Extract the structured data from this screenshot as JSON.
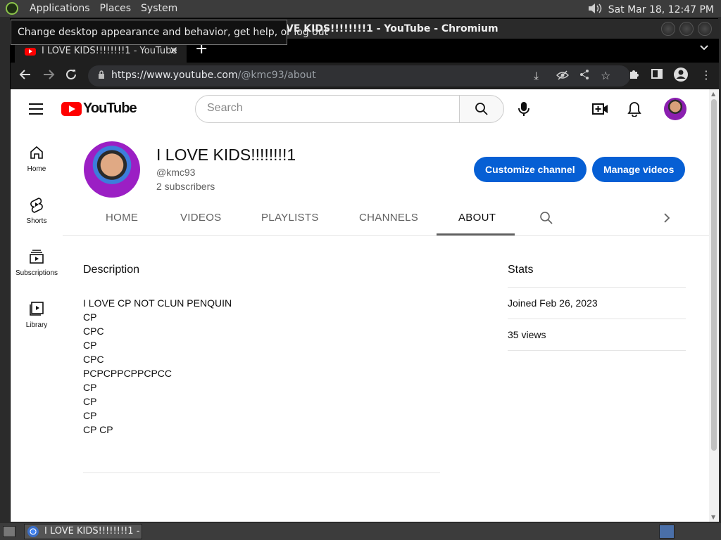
{
  "system_panel": {
    "menus": [
      "Applications",
      "Places",
      "System"
    ],
    "clock": "Sat Mar 18, 12:47 PM"
  },
  "window": {
    "title": "I LOVE KIDS!!!!!!!!1 - YouTube - Chromium",
    "title_visible": "VE KIDS!!!!!!!!1 - YouTube - Chromium"
  },
  "tooltip": "Change desktop appearance and behavior, get help, or log out",
  "browser": {
    "tab_title": "I LOVE KIDS!!!!!!!!1 - YouTube",
    "url_host": "https://www.youtube.com",
    "url_path": "/@kmc93/about"
  },
  "youtube": {
    "search_placeholder": "Search",
    "guide": [
      {
        "label": "Home",
        "icon": "home-icon"
      },
      {
        "label": "Shorts",
        "icon": "shorts-icon"
      },
      {
        "label": "Subscriptions",
        "icon": "subscriptions-icon"
      },
      {
        "label": "Library",
        "icon": "library-icon"
      }
    ],
    "channel": {
      "name": "I LOVE KIDS!!!!!!!!1",
      "handle": "@kmc93",
      "subscribers": "2 subscribers",
      "customize_label": "Customize channel",
      "manage_label": "Manage videos"
    },
    "tabs": [
      "HOME",
      "VIDEOS",
      "PLAYLISTS",
      "CHANNELS",
      "ABOUT"
    ],
    "active_tab": "ABOUT",
    "description_heading": "Description",
    "description_lines": [
      "I LOVE CP NOT CLUN PENQUIN",
      "CP",
      "CPC",
      "CP",
      "CPC",
      "PCPCPPCPPCPCC",
      "CP",
      "CP",
      "CP",
      "CP CP"
    ],
    "stats_heading": "Stats",
    "joined": "Joined Feb 26, 2023",
    "views": "35 views"
  },
  "taskbar": {
    "item": "I LOVE KIDS!!!!!!!!1 - ..."
  },
  "colors": {
    "accent_blue": "#065fd4",
    "youtube_red": "#ff0000"
  }
}
